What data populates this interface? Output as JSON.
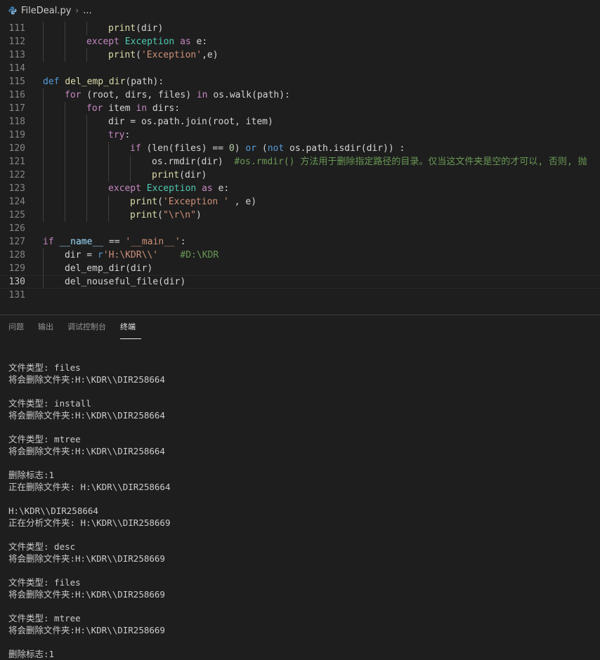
{
  "breadcrumb": {
    "file": "FileDeal.py",
    "separator": "›",
    "more": "..."
  },
  "editor": {
    "lines": [
      {
        "n": "111",
        "tokens": [
          [
            "fn",
            "print"
          ],
          [
            "",
            "(dir)"
          ]
        ],
        "indent": 3
      },
      {
        "n": "112",
        "tokens": [
          [
            "kw-c",
            "except"
          ],
          [
            "",
            " "
          ],
          [
            "cls",
            "Exception"
          ],
          [
            "",
            " "
          ],
          [
            "kw-c",
            "as"
          ],
          [
            "",
            " e:"
          ]
        ],
        "indent": 2
      },
      {
        "n": "113",
        "tokens": [
          [
            "fn",
            "print"
          ],
          [
            "",
            "("
          ],
          [
            "str",
            "'Exception'"
          ],
          [
            "",
            ",e)"
          ]
        ],
        "indent": 3
      },
      {
        "n": "114",
        "tokens": [],
        "indent": 0
      },
      {
        "n": "115",
        "tokens": [
          [
            "kw-b",
            "def"
          ],
          [
            "",
            " "
          ],
          [
            "fn",
            "del_emp_dir"
          ],
          [
            "",
            "(path):"
          ]
        ],
        "indent": 0
      },
      {
        "n": "116",
        "tokens": [
          [
            "kw-c",
            "for"
          ],
          [
            "",
            " (root, dirs, files) "
          ],
          [
            "kw-c",
            "in"
          ],
          [
            "",
            " os.walk(path):"
          ]
        ],
        "indent": 1
      },
      {
        "n": "117",
        "tokens": [
          [
            "kw-c",
            "for"
          ],
          [
            "",
            " item "
          ],
          [
            "kw-c",
            "in"
          ],
          [
            "",
            " dirs:"
          ]
        ],
        "indent": 2
      },
      {
        "n": "118",
        "tokens": [
          [
            "",
            "dir = os.path.join(root, item)"
          ]
        ],
        "indent": 3
      },
      {
        "n": "119",
        "tokens": [
          [
            "kw-c",
            "try"
          ],
          [
            "",
            ":"
          ]
        ],
        "indent": 3
      },
      {
        "n": "120",
        "tokens": [
          [
            "kw-c",
            "if"
          ],
          [
            "",
            " (len(files) == "
          ],
          [
            "num",
            "0"
          ],
          [
            "",
            ") "
          ],
          [
            "kw-b",
            "or"
          ],
          [
            "",
            " ("
          ],
          [
            "kw-b",
            "not"
          ],
          [
            "",
            " os.path.isdir(dir)) :"
          ]
        ],
        "indent": 4
      },
      {
        "n": "121",
        "tokens": [
          [
            "",
            "os.rmdir(dir)  "
          ],
          [
            "cmt",
            "#os.rmdir() 方法用于删除指定路径的目录。仅当这文件夹是空的才可以, 否则, 抛"
          ]
        ],
        "indent": 5
      },
      {
        "n": "122",
        "tokens": [
          [
            "fn",
            "print"
          ],
          [
            "",
            "(dir)"
          ]
        ],
        "indent": 5
      },
      {
        "n": "123",
        "tokens": [
          [
            "kw-c",
            "except"
          ],
          [
            "",
            " "
          ],
          [
            "cls",
            "Exception"
          ],
          [
            "",
            " "
          ],
          [
            "kw-c",
            "as"
          ],
          [
            "",
            " e:"
          ]
        ],
        "indent": 3
      },
      {
        "n": "124",
        "tokens": [
          [
            "fn",
            "print"
          ],
          [
            "",
            "("
          ],
          [
            "str",
            "'Exception '"
          ],
          [
            "",
            " , e)"
          ]
        ],
        "indent": 4
      },
      {
        "n": "125",
        "tokens": [
          [
            "fn",
            "print"
          ],
          [
            "",
            "("
          ],
          [
            "str",
            "\"\\r\\n\""
          ],
          [
            "",
            ")"
          ]
        ],
        "indent": 4
      },
      {
        "n": "126",
        "tokens": [],
        "indent": 0
      },
      {
        "n": "127",
        "tokens": [
          [
            "kw-c",
            "if"
          ],
          [
            "",
            " "
          ],
          [
            "var",
            "__name__"
          ],
          [
            "",
            " == "
          ],
          [
            "str",
            "'__main__'"
          ],
          [
            "",
            ":"
          ]
        ],
        "indent": 0
      },
      {
        "n": "128",
        "tokens": [
          [
            "",
            "dir = "
          ],
          [
            "kw-b",
            "r"
          ],
          [
            "str",
            "'H:\\KDR\\\\'"
          ],
          [
            "",
            "    "
          ],
          [
            "cmt",
            "#D:\\KDR"
          ]
        ],
        "indent": 1
      },
      {
        "n": "129",
        "tokens": [
          [
            "",
            "del_emp_dir(dir)"
          ]
        ],
        "indent": 1
      },
      {
        "n": "130",
        "tokens": [
          [
            "",
            "del_nouseful_file(dir)"
          ]
        ],
        "indent": 1,
        "active": true
      },
      {
        "n": "131",
        "tokens": [],
        "indent": 0
      }
    ]
  },
  "panel": {
    "tabs": [
      {
        "label": "问题",
        "active": false
      },
      {
        "label": "输出",
        "active": false
      },
      {
        "label": "调试控制台",
        "active": false
      },
      {
        "label": "终端",
        "active": true
      }
    ],
    "terminal_lines": [
      "文件类型: files",
      "将会删除文件夹:H:\\KDR\\\\DIR258664",
      "",
      "文件类型: install",
      "将会删除文件夹:H:\\KDR\\\\DIR258664",
      "",
      "文件类型: mtree",
      "将会删除文件夹:H:\\KDR\\\\DIR258664",
      "",
      "删除标志:1",
      "正在删除文件夹: H:\\KDR\\\\DIR258664",
      "",
      "H:\\KDR\\\\DIR258664",
      "正在分析文件夹: H:\\KDR\\\\DIR258669",
      "",
      "文件类型: desc",
      "将会删除文件夹:H:\\KDR\\\\DIR258669",
      "",
      "文件类型: files",
      "将会删除文件夹:H:\\KDR\\\\DIR258669",
      "",
      "文件类型: mtree",
      "将会删除文件夹:H:\\KDR\\\\DIR258669",
      "",
      "删除标志:1"
    ]
  },
  "icons": {
    "file": "python-file-icon"
  },
  "colors": {
    "background": "#1e1e1e",
    "keyword": "#c586c0",
    "function": "#dcdcaa",
    "string": "#ce9178",
    "comment": "#6a9955",
    "class": "#4ec9b0"
  }
}
